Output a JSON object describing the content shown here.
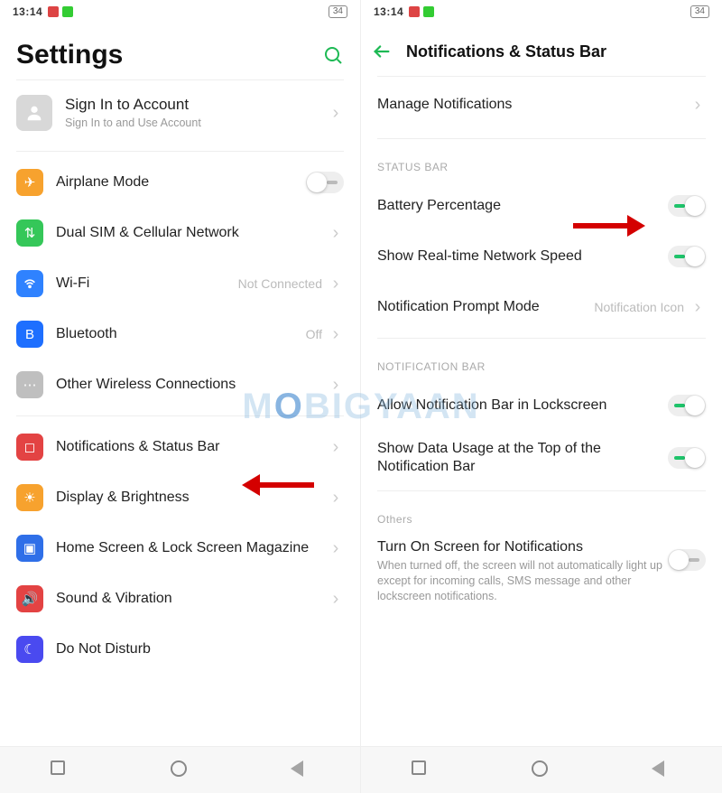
{
  "status": {
    "time": "13:14",
    "battery": "34"
  },
  "left": {
    "title": "Settings",
    "account": {
      "title": "Sign In to Account",
      "sub": "Sign In to and Use Account"
    },
    "rows": [
      {
        "label": "Airplane Mode"
      },
      {
        "label": "Dual SIM & Cellular Network"
      },
      {
        "label": "Wi-Fi",
        "value": "Not Connected"
      },
      {
        "label": "Bluetooth",
        "value": "Off"
      },
      {
        "label": "Other Wireless Connections"
      },
      {
        "label": "Notifications & Status Bar"
      },
      {
        "label": "Display & Brightness"
      },
      {
        "label": "Home Screen & Lock Screen Magazine"
      },
      {
        "label": "Sound & Vibration"
      },
      {
        "label": "Do Not Disturb"
      }
    ]
  },
  "right": {
    "title": "Notifications & Status Bar",
    "manage": "Manage Notifications",
    "section1": "STATUS BAR",
    "rows1": [
      {
        "label": "Battery Percentage"
      },
      {
        "label": "Show Real-time Network Speed"
      },
      {
        "label": "Notification Prompt Mode",
        "value": "Notification Icon"
      }
    ],
    "section2": "NOTIFICATION BAR",
    "rows2": [
      {
        "label": "Allow Notification Bar in Lockscreen"
      },
      {
        "label": "Show Data Usage at the Top of the Notification Bar"
      }
    ],
    "section3": "Others",
    "rows3": [
      {
        "label": "Turn On Screen for Notifications",
        "sub": "When turned off, the screen will not automatically light up except for incoming calls, SMS message and other lockscreen notifications."
      }
    ]
  },
  "watermark": "MOBIGYAAN"
}
